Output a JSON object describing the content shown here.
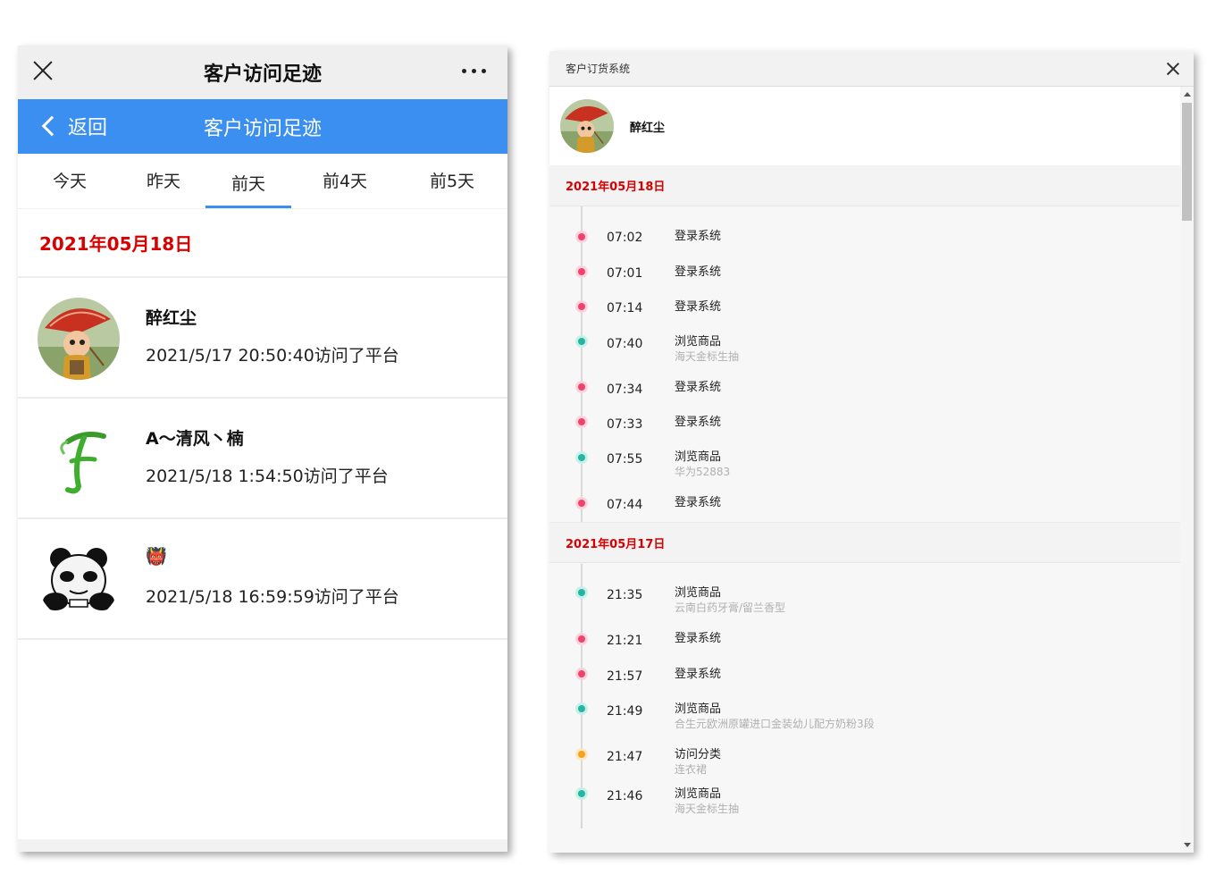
{
  "phone": {
    "title": "客户访问足迹",
    "back_label": "返回",
    "header_title": "客户访问足迹",
    "tabs": [
      "今天",
      "昨天",
      "前天",
      "前4天",
      "前5天"
    ],
    "active_tab": "前天",
    "date": "2021年05月18日",
    "visitors": [
      {
        "name": "醉红尘",
        "visit": "2021/5/17 20:50:40访问了平台",
        "avatar": "monk-with-umbrella-avatar"
      },
      {
        "name": "A～清风丶楠",
        "visit": "2021/5/18 1:54:50访问了平台",
        "avatar": "green-letter-f-avatar"
      },
      {
        "name": "👹",
        "visit": "2021/5/18 16:59:59访问了平台",
        "avatar": "panda-meme-avatar"
      }
    ]
  },
  "window": {
    "title": "客户订货系统",
    "user_name": "醉红尘",
    "days": [
      {
        "date": "2021年05月18日",
        "events": [
          {
            "time": "07:02",
            "action": "登录系统",
            "detail": "",
            "kind": "login"
          },
          {
            "time": "07:01",
            "action": "登录系统",
            "detail": "",
            "kind": "login"
          },
          {
            "time": "07:14",
            "action": "登录系统",
            "detail": "",
            "kind": "login"
          },
          {
            "time": "07:40",
            "action": "浏览商品",
            "detail": "海天金标生抽",
            "kind": "browse"
          },
          {
            "time": "07:34",
            "action": "登录系统",
            "detail": "",
            "kind": "login"
          },
          {
            "time": "07:33",
            "action": "登录系统",
            "detail": "",
            "kind": "login"
          },
          {
            "time": "07:55",
            "action": "浏览商品",
            "detail": "华为52883",
            "kind": "browse"
          },
          {
            "time": "07:44",
            "action": "登录系统",
            "detail": "",
            "kind": "login"
          }
        ]
      },
      {
        "date": "2021年05月17日",
        "events": [
          {
            "time": "21:35",
            "action": "浏览商品",
            "detail": "云南白药牙膏/留兰香型",
            "kind": "browse"
          },
          {
            "time": "21:21",
            "action": "登录系统",
            "detail": "",
            "kind": "login"
          },
          {
            "time": "21:57",
            "action": "登录系统",
            "detail": "",
            "kind": "login"
          },
          {
            "time": "21:49",
            "action": "浏览商品",
            "detail": "合生元欧洲原罐进口金装幼儿配方奶粉3段",
            "kind": "browse"
          },
          {
            "time": "21:47",
            "action": "访问分类",
            "detail": "连衣裙",
            "kind": "category"
          },
          {
            "time": "21:46",
            "action": "浏览商品",
            "detail": "海天金标生抽",
            "kind": "browse"
          }
        ]
      }
    ]
  },
  "colors": {
    "accent_blue": "#3a8ff0",
    "date_red": "#d80000",
    "login_dot": "#f2416b",
    "browse_dot": "#23b6a3",
    "category_dot": "#f7a21b"
  }
}
